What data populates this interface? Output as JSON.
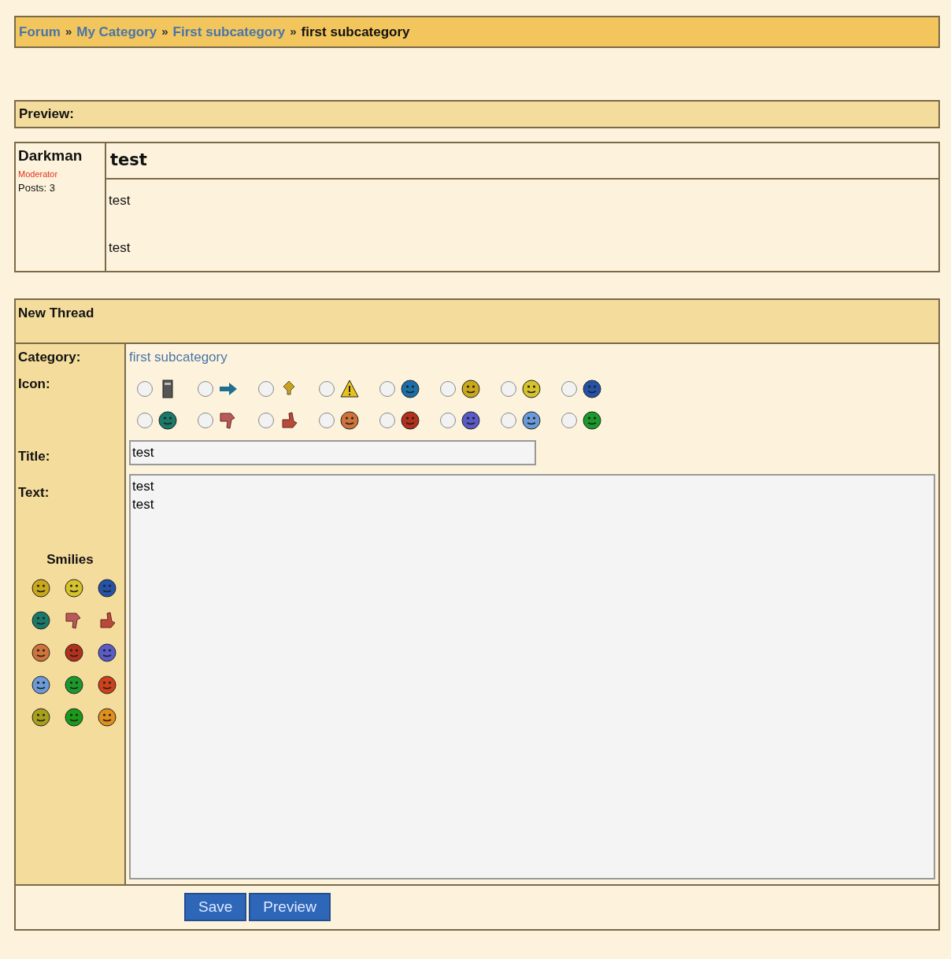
{
  "breadcrumb_separator": "»",
  "breadcrumb": [
    {
      "text": "Forum",
      "kind": "link"
    },
    {
      "text": "My Category",
      "kind": "link"
    },
    {
      "text": "First subcategory",
      "kind": "link"
    },
    {
      "text": "first subcategory",
      "kind": "current"
    }
  ],
  "preview": {
    "heading": "Preview:",
    "author": "Darkman",
    "role": "Moderator",
    "posts": "Posts: 3",
    "title": "test",
    "body": [
      "test",
      "test"
    ]
  },
  "form": {
    "heading": "New Thread",
    "category_label": "Category:",
    "category": "first subcategory",
    "icon_label": "Icon:",
    "icons": [
      {
        "kind": "note",
        "color": "#555555",
        "selected": false
      },
      {
        "kind": "arrow",
        "color": "#1f6f8f",
        "selected": false
      },
      {
        "kind": "bulb",
        "color": "#c9a21a",
        "selected": false
      },
      {
        "kind": "warning",
        "color": "#e8c21a",
        "selected": false
      },
      {
        "kind": "face",
        "color": "#1a6fa8",
        "selected": false
      },
      {
        "kind": "face",
        "color": "#c9a81a",
        "selected": false
      },
      {
        "kind": "face",
        "color": "#d6c22a",
        "selected": false
      },
      {
        "kind": "face",
        "color": "#2452a8",
        "selected": false
      },
      {
        "kind": "face",
        "color": "#1a7a6a",
        "selected": false
      },
      {
        "kind": "thumb-down",
        "color": "#b85a5a",
        "selected": false
      },
      {
        "kind": "thumb-up",
        "color": "#b84a3a",
        "selected": false
      },
      {
        "kind": "face",
        "color": "#d0733a",
        "selected": false
      },
      {
        "kind": "face",
        "color": "#b3301a",
        "selected": false
      },
      {
        "kind": "face",
        "color": "#5a5ac8",
        "selected": false
      },
      {
        "kind": "face",
        "color": "#6a9ad8",
        "selected": false
      },
      {
        "kind": "face",
        "color": "#1a9a2a",
        "selected": false
      }
    ],
    "title_label": "Title:",
    "title_value": "test",
    "text_label": "Text:",
    "text_value": "test\ntest",
    "smilies_label": "Smilies",
    "smilies": [
      {
        "kind": "face",
        "color": "#c9a81a"
      },
      {
        "kind": "face",
        "color": "#d6c22a"
      },
      {
        "kind": "face",
        "color": "#2452a8"
      },
      {
        "kind": "face",
        "color": "#1a7a6a"
      },
      {
        "kind": "thumb-down",
        "color": "#b85a5a"
      },
      {
        "kind": "thumb-up",
        "color": "#b84a3a"
      },
      {
        "kind": "face",
        "color": "#d0733a"
      },
      {
        "kind": "face",
        "color": "#b3301a"
      },
      {
        "kind": "face",
        "color": "#5a5ac8"
      },
      {
        "kind": "face",
        "color": "#6a9ad8"
      },
      {
        "kind": "face",
        "color": "#1a9a2a"
      },
      {
        "kind": "face",
        "color": "#d0401a"
      },
      {
        "kind": "face",
        "color": "#a8a01a"
      },
      {
        "kind": "face",
        "color": "#1a9a1a"
      },
      {
        "kind": "face",
        "color": "#e0901a"
      }
    ],
    "buttons": [
      "Save",
      "Preview"
    ]
  }
}
